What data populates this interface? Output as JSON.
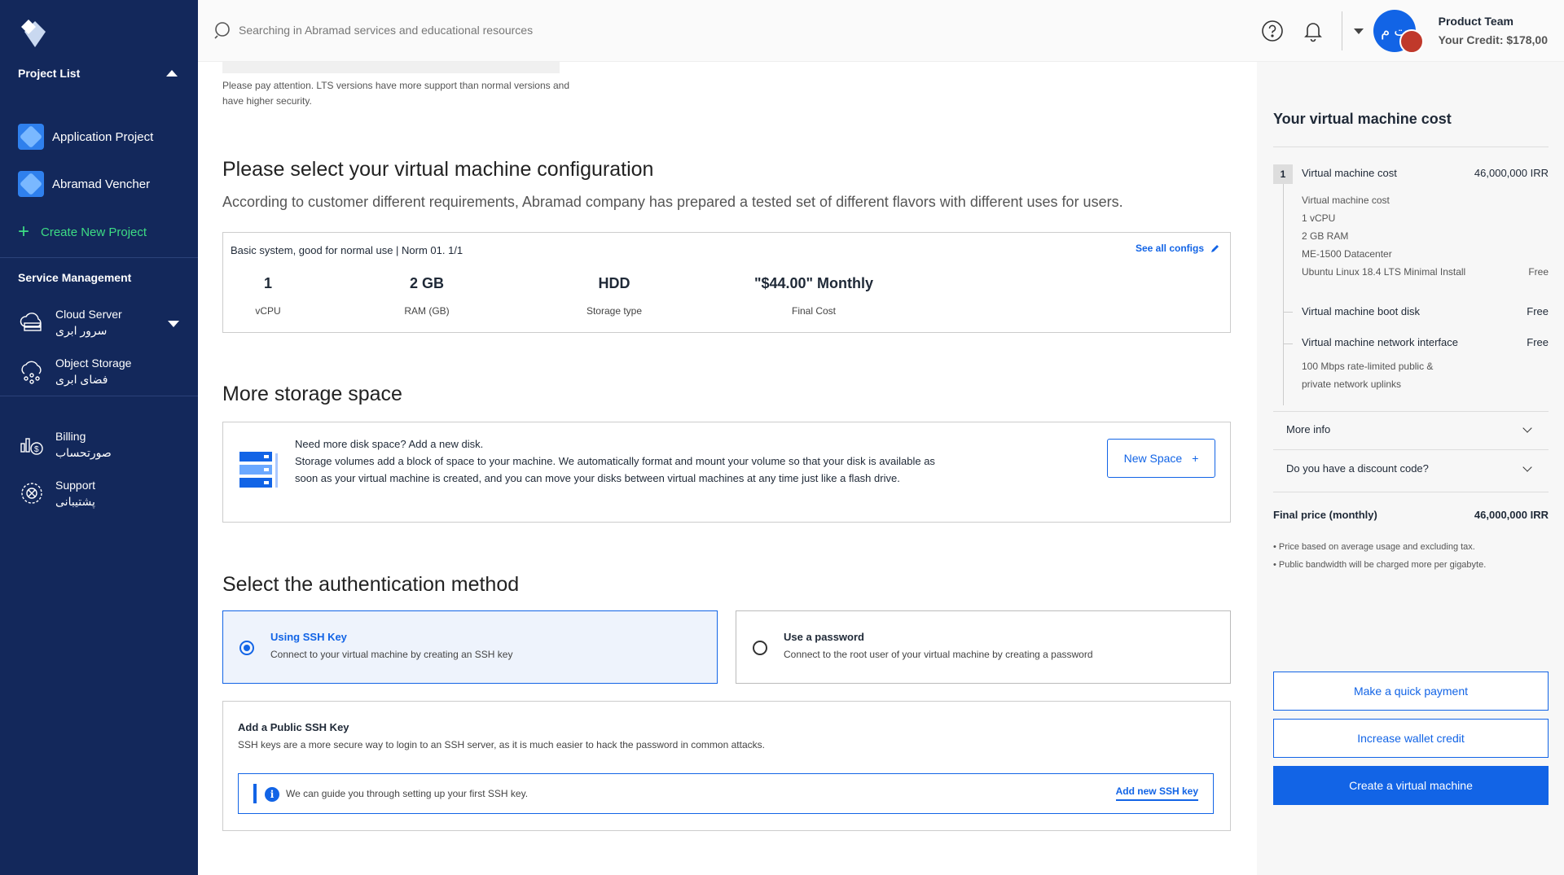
{
  "sidebar": {
    "project_list_label": "Project List",
    "projects": [
      {
        "label": "Application Project"
      },
      {
        "label": "Abramad Vencher"
      }
    ],
    "create_project_label": "Create New Project",
    "service_management_label": "Service Management",
    "services": [
      {
        "label": "Cloud Server",
        "label_fa": "سرور ابری",
        "icon": "cloud-server-icon"
      },
      {
        "label": "Object Storage",
        "label_fa": "فضای ابری",
        "icon": "object-storage-icon"
      },
      {
        "label": "Billing",
        "label_fa": "صورتحساب",
        "icon": "billing-icon"
      },
      {
        "label": "Support",
        "label_fa": "پشتیبانی",
        "icon": "support-icon"
      }
    ]
  },
  "topbar": {
    "search_placeholder": "Searching in Abramad services and educational resources",
    "avatar_initials": "ت م",
    "user_name": "Product Team",
    "credit": "Your Credit: $178,00"
  },
  "main": {
    "lts_note": "Please pay attention. LTS versions have more support than normal versions and have higher security.",
    "config": {
      "heading": "Please select your virtual machine configuration",
      "subheading": "According to customer different requirements, Abramad company has prepared a tested set of different flavors with different uses for users.",
      "plan_title": "Basic system, good for normal use | Norm 01. 1/1",
      "see_all": "See all configs",
      "specs": [
        {
          "value": "1",
          "label": "vCPU"
        },
        {
          "value": "2 GB",
          "label": "RAM (GB)"
        },
        {
          "value": "HDD",
          "label": "Storage type"
        },
        {
          "value": "\"$44.00\" Monthly",
          "label": "Final Cost"
        }
      ]
    },
    "storage": {
      "heading": "More storage space",
      "line1": "Need more disk space? Add a new disk.",
      "line2": "Storage volumes add a block of space to your machine. We automatically format and mount your volume so that your disk is available as soon as your virtual machine is created, and you can move your disks between virtual machines at any time just like a flash drive.",
      "button": "New Space",
      "button_icon": "+"
    },
    "auth": {
      "heading": "Select the authentication method",
      "options": [
        {
          "title": "Using SSH Key",
          "desc": "Connect to your virtual machine by creating an SSH key",
          "selected": true
        },
        {
          "title": "Use a password",
          "desc": "Connect to the root user of your virtual machine by creating a password",
          "selected": false
        }
      ],
      "ssh_title": "Add a Public SSH Key",
      "ssh_desc": "SSH keys are a more secure way to login to an SSH server, as it is much easier to hack the password in common attacks.",
      "guide_text": "We can guide you through setting up your first SSH key.",
      "add_key": "Add new SSH key"
    }
  },
  "panel": {
    "title": "Your virtual machine cost",
    "item_number": "1",
    "item_label": "Virtual machine cost",
    "item_price": "46,000,000 IRR",
    "details": [
      "Virtual machine cost",
      "1 vCPU",
      "2 GB RAM",
      "ME-1500 Datacenter",
      "Ubuntu Linux 18.4 LTS Minimal Install"
    ],
    "details_free": "Free",
    "boot_disk": "Virtual machine boot disk",
    "boot_disk_price": "Free",
    "network": "Virtual machine network interface",
    "network_price": "Free",
    "network_desc1": "100 Mbps rate-limited public &",
    "network_desc2": "private network uplinks",
    "more_info": "More info",
    "discount": "Do you have a discount code?",
    "final_label": "Final price (monthly)",
    "final_price": "46,000,000 IRR",
    "footnote1": "• Price based on average usage and excluding tax.",
    "footnote2": "• Public bandwidth will be charged more per gigabyte.",
    "btn_quick": "Make a quick payment",
    "btn_wallet": "Increase wallet credit",
    "btn_create": "Create a virtual machine"
  },
  "colors": {
    "sidebar": "#13285b",
    "accent": "#1264e6",
    "create_green": "#3ddc84"
  }
}
